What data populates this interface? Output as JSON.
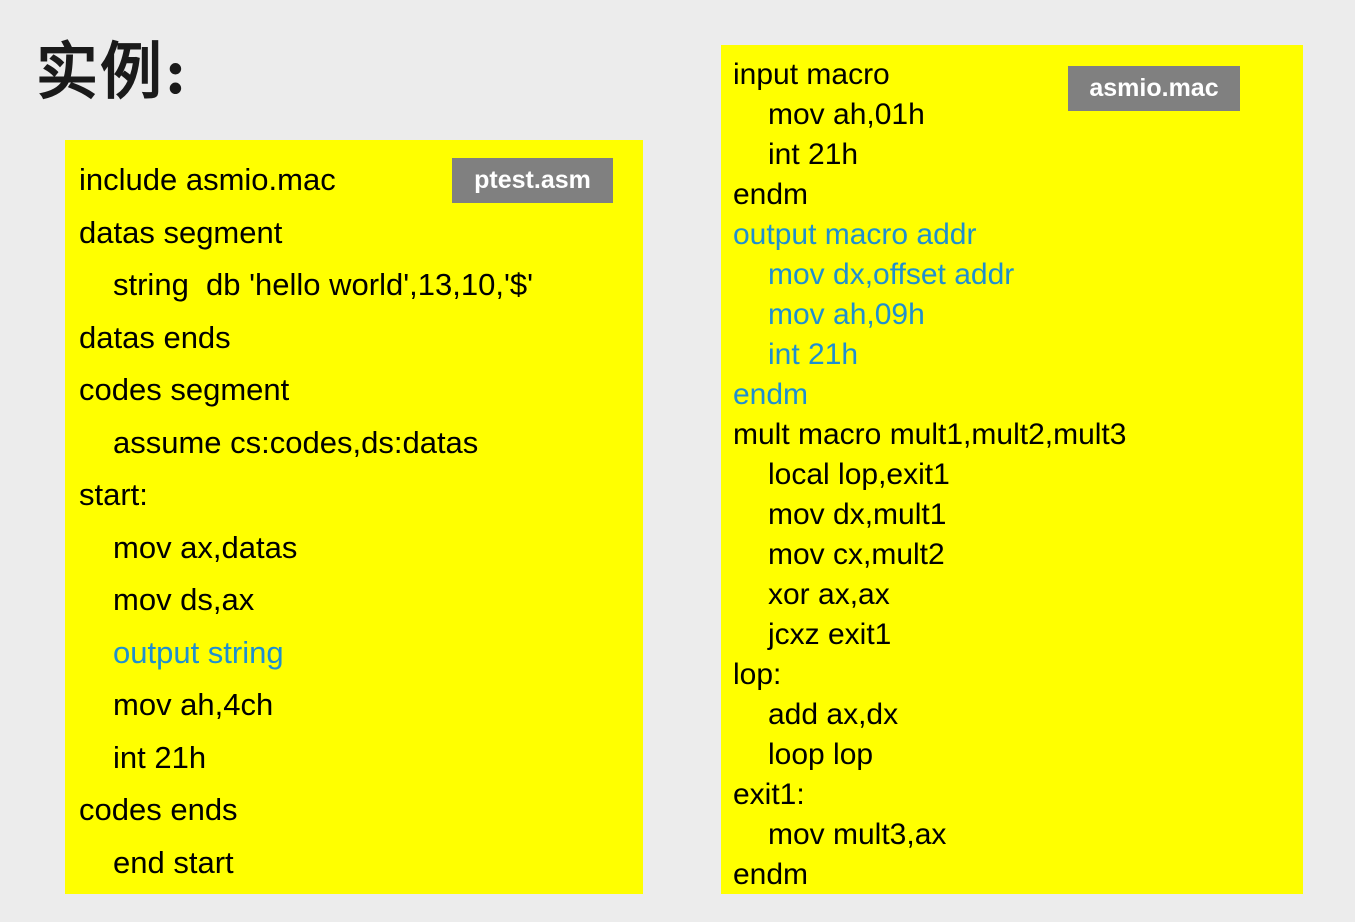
{
  "slide": {
    "title": "实例:",
    "background_color": "#ececec",
    "code_background_color": "#ffff00",
    "badge_background_color": "#808080",
    "macro_highlight_color": "#1f8fd0",
    "default_text_color": "#000000"
  },
  "left_panel": {
    "badge_label": "ptest.asm",
    "lines": [
      {
        "text": "include asmio.mac",
        "indent": 0,
        "color": "black"
      },
      {
        "text": "datas segment",
        "indent": 0,
        "color": "black"
      },
      {
        "text": "string  db 'hello world',13,10,'$'",
        "indent": 1,
        "color": "black"
      },
      {
        "text": "datas ends",
        "indent": 0,
        "color": "black"
      },
      {
        "text": "codes segment",
        "indent": 0,
        "color": "black"
      },
      {
        "text": "assume cs:codes,ds:datas",
        "indent": 1,
        "color": "black"
      },
      {
        "text": "start:",
        "indent": 0,
        "color": "black"
      },
      {
        "text": "mov ax,datas",
        "indent": 1,
        "color": "black"
      },
      {
        "text": "mov ds,ax",
        "indent": 1,
        "color": "black"
      },
      {
        "text": "output string",
        "indent": 1,
        "color": "blue"
      },
      {
        "text": "mov ah,4ch",
        "indent": 1,
        "color": "black"
      },
      {
        "text": "int 21h",
        "indent": 1,
        "color": "black"
      },
      {
        "text": "codes ends",
        "indent": 0,
        "color": "black"
      },
      {
        "text": "end start",
        "indent": 1,
        "color": "black"
      }
    ]
  },
  "right_panel": {
    "badge_label": "asmio.mac",
    "lines": [
      {
        "text": "input macro",
        "indent": 0,
        "color": "black"
      },
      {
        "text": "mov ah,01h",
        "indent": 1,
        "color": "black"
      },
      {
        "text": "int 21h",
        "indent": 1,
        "color": "black"
      },
      {
        "text": "endm",
        "indent": 0,
        "color": "black"
      },
      {
        "text": "output macro addr",
        "indent": 0,
        "color": "blue"
      },
      {
        "text": "mov dx,offset addr",
        "indent": 1,
        "color": "blue"
      },
      {
        "text": "mov ah,09h",
        "indent": 1,
        "color": "blue"
      },
      {
        "text": "int 21h",
        "indent": 1,
        "color": "blue"
      },
      {
        "text": "endm",
        "indent": 0,
        "color": "blue"
      },
      {
        "text": "mult macro mult1,mult2,mult3",
        "indent": 0,
        "color": "black"
      },
      {
        "text": "local lop,exit1",
        "indent": 1,
        "color": "black"
      },
      {
        "text": "mov dx,mult1",
        "indent": 1,
        "color": "black"
      },
      {
        "text": "mov cx,mult2",
        "indent": 1,
        "color": "black"
      },
      {
        "text": "xor ax,ax",
        "indent": 1,
        "color": "black"
      },
      {
        "text": "jcxz exit1",
        "indent": 1,
        "color": "black"
      },
      {
        "text": "lop:",
        "indent": 0,
        "color": "black"
      },
      {
        "text": "add ax,dx",
        "indent": 1,
        "color": "black"
      },
      {
        "text": "loop lop",
        "indent": 1,
        "color": "black"
      },
      {
        "text": "exit1:",
        "indent": 0,
        "color": "black"
      },
      {
        "text": "mov mult3,ax",
        "indent": 1,
        "color": "black"
      },
      {
        "text": "endm",
        "indent": 0,
        "color": "black"
      }
    ]
  }
}
